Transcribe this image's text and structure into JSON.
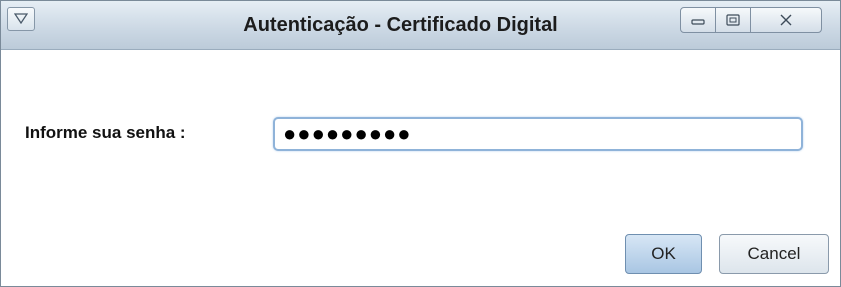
{
  "window": {
    "title": "Autenticação - Certificado Digital"
  },
  "form": {
    "password_label": "Informe sua senha :",
    "password_value": "●●●●●●●●●"
  },
  "buttons": {
    "ok_label": "OK",
    "cancel_label": "Cancel"
  },
  "icons": {
    "system_menu": "chevron-down-icon",
    "minimize": "minimize-icon",
    "maximize": "maximize-icon",
    "close": "close-icon"
  }
}
